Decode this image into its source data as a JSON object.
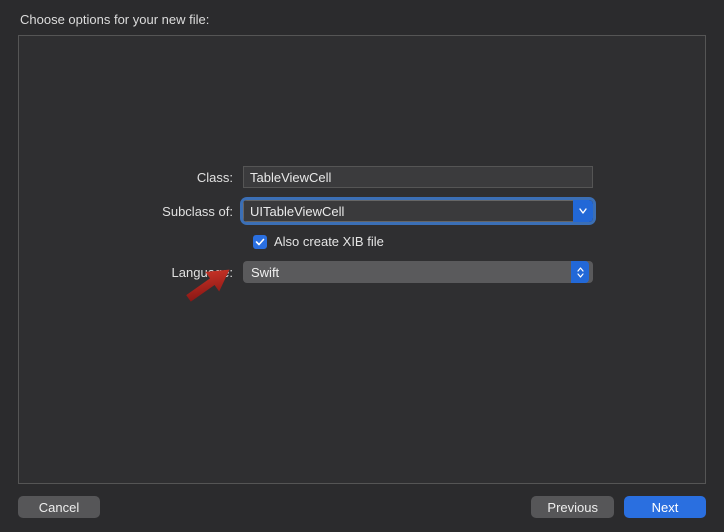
{
  "title": "Choose options for your new file:",
  "form": {
    "class_label": "Class:",
    "class_value": "TableViewCell",
    "subclass_label": "Subclass of:",
    "subclass_value": "UITableViewCell",
    "xib_label": "Also create XIB file",
    "xib_checked": true,
    "language_label": "Language:",
    "language_value": "Swift"
  },
  "buttons": {
    "cancel": "Cancel",
    "previous": "Previous",
    "next": "Next"
  }
}
